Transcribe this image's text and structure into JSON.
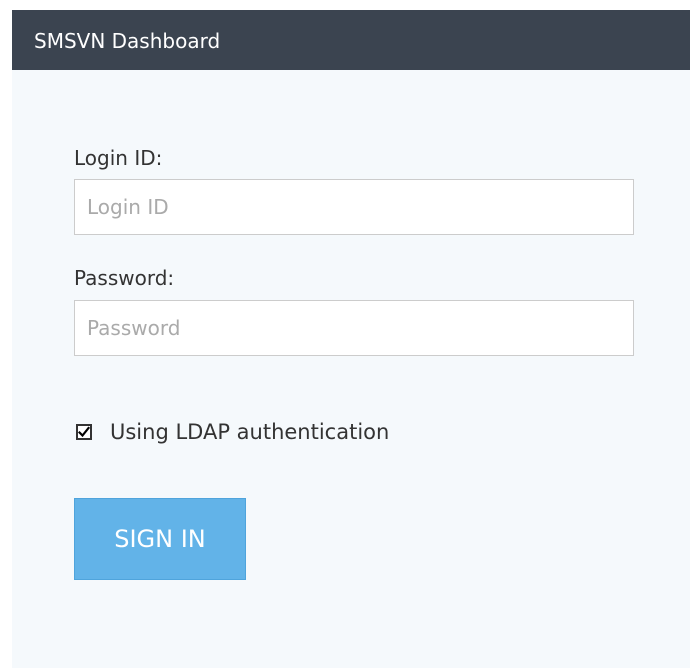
{
  "header": {
    "title": "SMSVN Dashboard"
  },
  "login_form": {
    "login_label": "Login ID:",
    "login_placeholder": "Login ID",
    "login_value": "",
    "password_label": "Password:",
    "password_placeholder": "Password",
    "password_value": "",
    "ldap_checkbox": {
      "label": "Using LDAP authentication",
      "checked": true
    },
    "submit_label": "SIGN IN"
  },
  "colors": {
    "header_background": "#3b4450",
    "panel_background": "#f5f9fc",
    "button_background": "#62b3e8",
    "button_text": "#ffffff"
  },
  "icons": {
    "checkbox": "checkmark-icon"
  }
}
